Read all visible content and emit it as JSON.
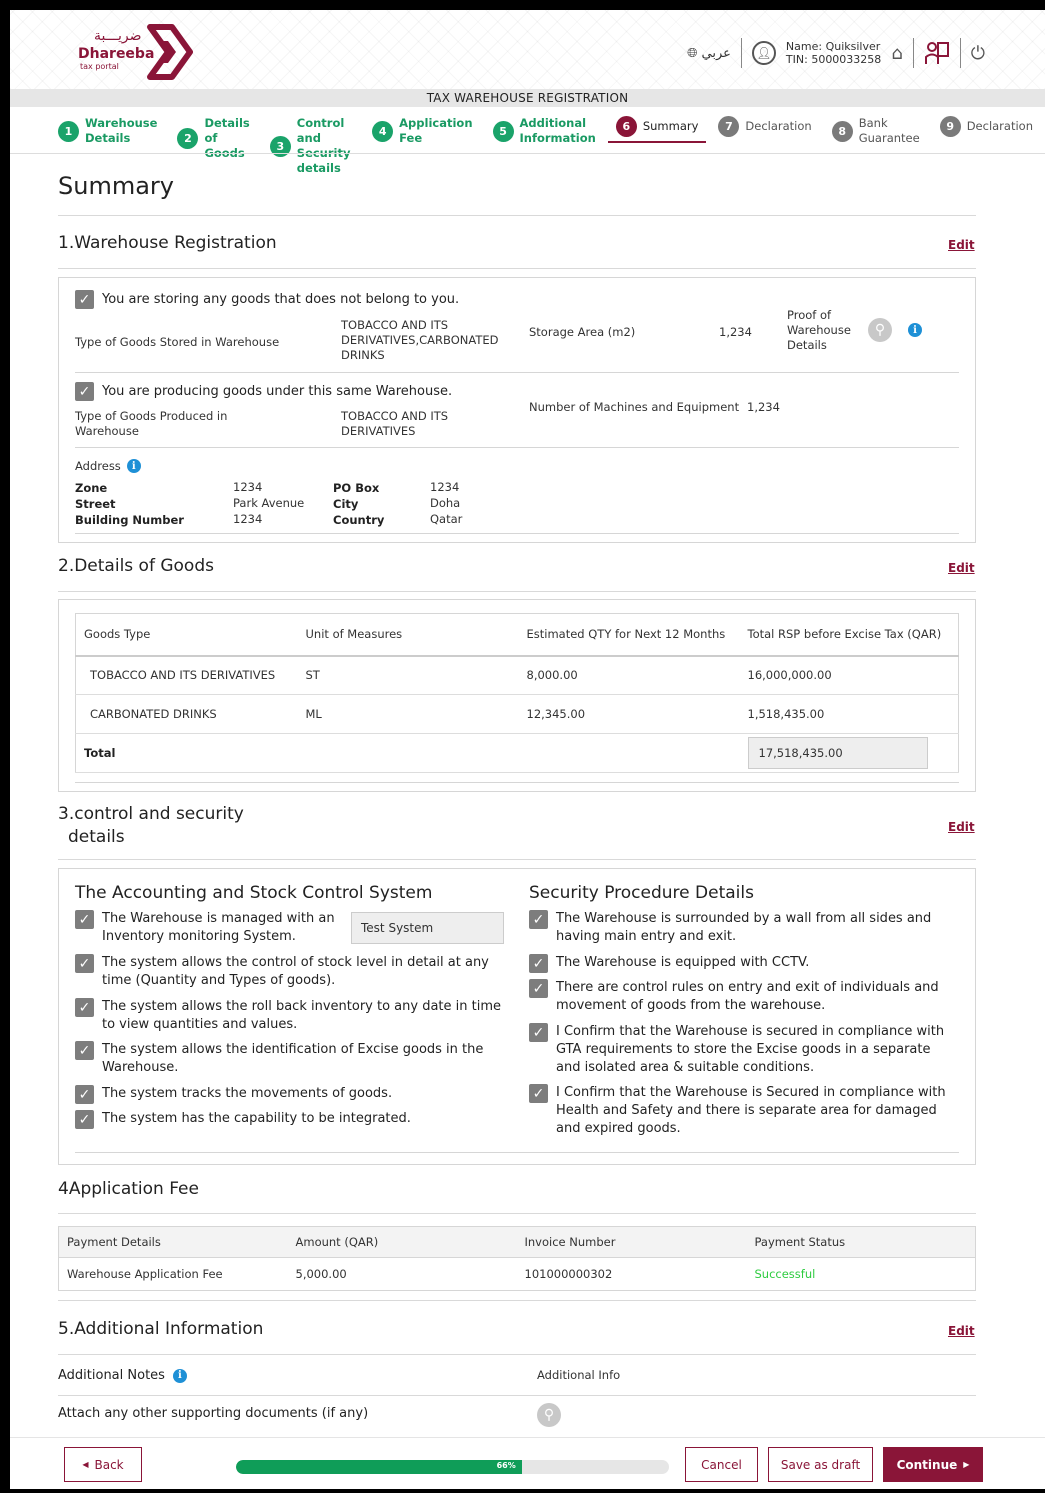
{
  "header": {
    "logo_arabic": "ضريـــبة",
    "logo_name": "Dhareeba",
    "logo_sub": "tax portal",
    "language": "عربي",
    "user_name": "Name: Quiksilver",
    "user_tin": "TIN: 5000033258"
  },
  "page_banner": "TAX WAREHOUSE REGISTRATION",
  "steps": [
    {
      "num": "1",
      "label": "Warehouse Details",
      "state": "done"
    },
    {
      "num": "2",
      "label": "Details of Goods",
      "state": "done"
    },
    {
      "num": "3",
      "label": "Control and Security details",
      "state": "done"
    },
    {
      "num": "4",
      "label": "Application Fee",
      "state": "done"
    },
    {
      "num": "5",
      "label": "Additional Information",
      "state": "done"
    },
    {
      "num": "6",
      "label": "Summary",
      "state": "current"
    },
    {
      "num": "7",
      "label": "Declaration",
      "state": "future"
    },
    {
      "num": "8",
      "label": "Bank Guarantee",
      "state": "future"
    },
    {
      "num": "9",
      "label": "Declaration",
      "state": "future"
    }
  ],
  "page_title": "Summary",
  "edit_label": "Edit",
  "section1": {
    "title": "1.Warehouse Registration",
    "storing_check": "You are storing any goods that does not belong to you.",
    "type_stored_label": "Type of Goods Stored in Warehouse",
    "type_stored_value": "TOBACCO AND ITS DERIVATIVES,CARBONATED DRINKS",
    "storage_area_label": "Storage Area (m2)",
    "storage_area_value": "1,234",
    "proof_label": "Proof of Warehouse Details",
    "producing_check": "You are producing goods under this same Warehouse.",
    "type_produced_label": "Type of Goods Produced in Warehouse",
    "type_produced_value": "TOBACCO AND ITS DERIVATIVES",
    "machines_label": "Number of Machines and Equipment",
    "machines_value": "1,234",
    "address_label": "Address",
    "address": {
      "zone_label": "Zone",
      "zone": "1234",
      "street_label": "Street",
      "street": "Park Avenue",
      "building_label": "Building Number",
      "building": "1234",
      "pobox_label": "PO Box",
      "pobox": "1234",
      "city_label": "City",
      "city": "Doha",
      "country_label": "Country",
      "country": "Qatar"
    }
  },
  "section2": {
    "title": "2.Details of Goods",
    "headers": [
      "Goods Type",
      "Unit of Measures",
      "Estimated QTY for Next 12 Months",
      "Total RSP before Excise Tax (QAR)"
    ],
    "rows": [
      [
        "TOBACCO AND ITS DERIVATIVES",
        "ST",
        "8,000.00",
        "16,000,000.00"
      ],
      [
        "CARBONATED DRINKS",
        "ML",
        "12,345.00",
        "1,518,435.00"
      ]
    ],
    "total_label": "Total",
    "total_value": "17,518,435.00"
  },
  "section3": {
    "title_line1": "3.control and security",
    "title_line2": "details",
    "left_heading": "The Accounting and Stock Control System",
    "left_items": [
      "The Warehouse is managed with an Inventory monitoring System.",
      "The system allows the control of stock level in detail at any time (Quantity and Types of goods).",
      "The system allows the roll back inventory to any date in time to view quantities and values.",
      "The system allows the identification of Excise goods in the Warehouse.",
      "The system tracks the movements of goods.",
      "The system has the capability to be integrated."
    ],
    "system_name": "Test System",
    "right_heading": "Security Procedure Details",
    "right_items": [
      "The Warehouse is surrounded by a wall from all sides and having main entry and exit.",
      "The Warehouse is equipped with CCTV.",
      "There are control rules on entry and exit of individuals and movement of goods from the warehouse.",
      "I Confirm that the Warehouse is secured in compliance with GTA requirements to store the Excise goods in a separate and isolated area & suitable conditions.",
      "I Confirm that the Warehouse is Secured in compliance with Health and Safety and there is separate area for damaged and expired goods."
    ]
  },
  "section4": {
    "title": "4Application Fee",
    "headers": [
      "Payment Details",
      "Amount (QAR)",
      "Invoice Number",
      "Payment Status"
    ],
    "row": [
      "Warehouse Application Fee",
      "5,000.00",
      "101000000302",
      "Successful"
    ],
    "status_color": "#2ecc40"
  },
  "section5": {
    "title": "5.Additional Information",
    "notes_label": "Additional Notes",
    "notes_value": "Additional Info",
    "attach_label": "Attach any other supporting documents (if any)"
  },
  "footer": {
    "back": "Back",
    "progress_text": "66%",
    "progress_value": 0.66,
    "cancel": "Cancel",
    "save_draft": "Save as draft",
    "continue": "Continue"
  },
  "colors": {
    "brand": "#8a1538",
    "step_done": "#1aa36a",
    "progress": "#0f9d58",
    "info": "#1e90d6"
  }
}
